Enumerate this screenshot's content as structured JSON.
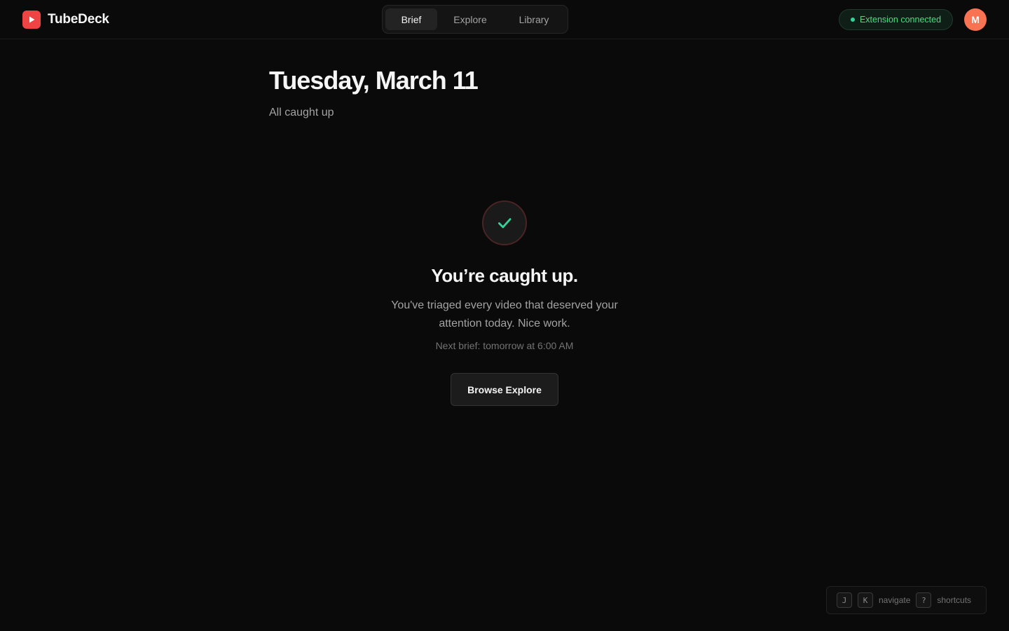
{
  "app": {
    "name": "TubeDeck",
    "logo_icon": "play-icon",
    "brand_color": "#ef4444"
  },
  "nav": {
    "tabs": [
      {
        "label": "Brief",
        "active": true
      },
      {
        "label": "Explore",
        "active": false
      },
      {
        "label": "Library",
        "active": false
      }
    ]
  },
  "status": {
    "label": "Extension connected",
    "color": "#34d399"
  },
  "user": {
    "initial": "M",
    "avatar_color": "#f97352"
  },
  "page": {
    "title": "Tuesday, March 11",
    "subtitle": "All caught up"
  },
  "empty_state": {
    "icon": "check-icon",
    "title": "You’re caught up.",
    "message": "You've triaged every video that deserved your attention today. Nice work.",
    "next_brief": "Next brief: tomorrow at 6:00 AM",
    "button_label": "Browse Explore"
  },
  "shortcuts": {
    "keys": [
      "J",
      "K"
    ],
    "navigate_label": "navigate",
    "help_key": "?",
    "shortcuts_label": "shortcuts"
  }
}
